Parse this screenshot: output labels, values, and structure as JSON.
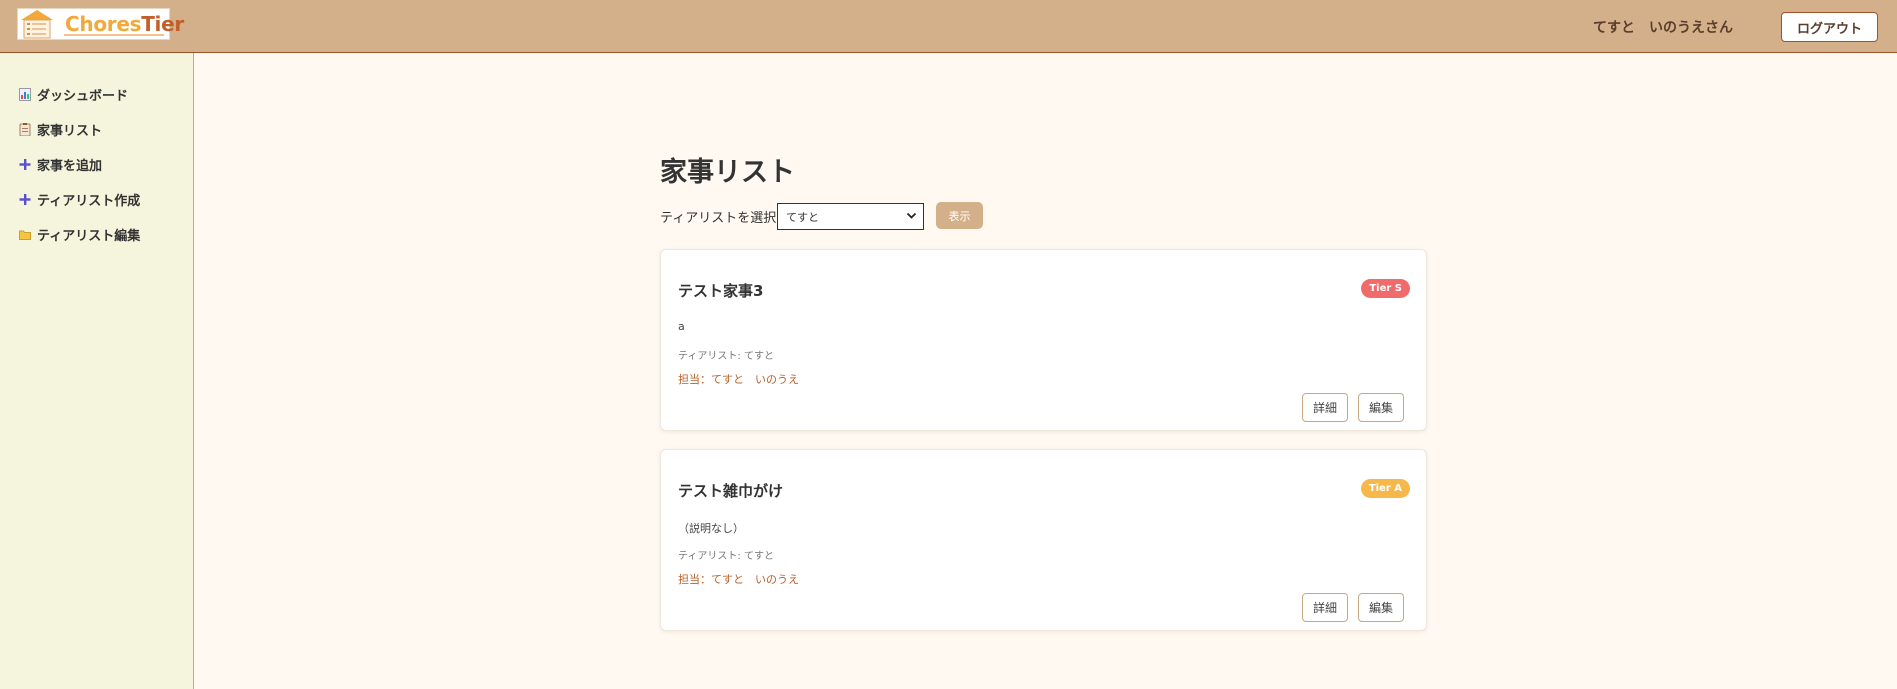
{
  "header": {
    "logo_part1": "Chores",
    "logo_part2": "Tier",
    "user_name": "てすと　いのうえさん",
    "logout_label": "ログアウト"
  },
  "sidebar": {
    "items": [
      {
        "label": "ダッシュボード",
        "icon": "chart-icon"
      },
      {
        "label": "家事リスト",
        "icon": "clipboard-icon"
      },
      {
        "label": "家事を追加",
        "icon": "plus-icon"
      },
      {
        "label": "ティアリスト作成",
        "icon": "plus-icon"
      },
      {
        "label": "ティアリスト編集",
        "icon": "folder-icon"
      }
    ]
  },
  "main": {
    "title": "家事リスト",
    "select_label": "ティアリストを選択",
    "select_value": "てすと",
    "show_button": "表示",
    "cards": [
      {
        "title": "テスト家事3",
        "tier": "Tier S",
        "tier_color": "#f06b6b",
        "description": "a",
        "tierlist": "ティアリスト: てすと",
        "assignee": "担当：てすと　いのうえ",
        "detail_label": "詳細",
        "edit_label": "編集"
      },
      {
        "title": "テスト雑巾がけ",
        "tier": "Tier A",
        "tier_color": "#f7b84b",
        "description": "（説明なし）",
        "tierlist": "ティアリスト: てすと",
        "assignee": "担当：てすと　いのうえ",
        "detail_label": "詳細",
        "edit_label": "編集"
      }
    ]
  },
  "colors": {
    "header_bg": "#d4b08a",
    "sidebar_bg": "#f4f5dc",
    "page_bg": "#fff9f2",
    "accent": "#a0522d"
  }
}
